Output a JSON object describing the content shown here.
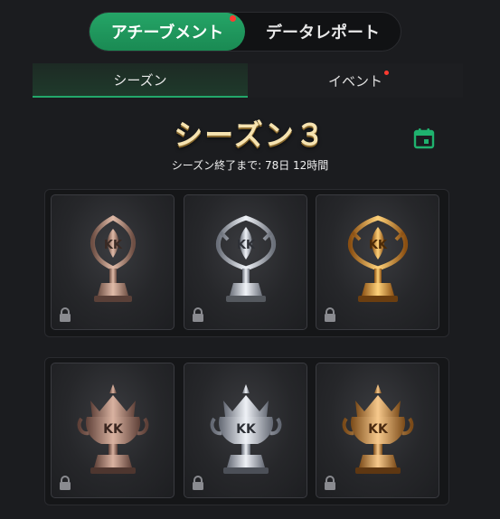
{
  "top_tabs": [
    {
      "label": "アチーブメント",
      "active": true,
      "badge": true
    },
    {
      "label": "データレポート",
      "active": false,
      "badge": false
    }
  ],
  "sub_tabs": [
    {
      "label": "シーズン",
      "active": true,
      "badge": false
    },
    {
      "label": "イベント",
      "active": false,
      "badge": true
    }
  ],
  "season": {
    "title": "シーズン３",
    "countdown": "シーズン終了まで: 78日 12時間"
  },
  "colors": {
    "accent": "#1f9a5e",
    "badge": "#ff3b30",
    "bronze": "#b48a73",
    "silver": "#c8ccd4",
    "gold": "#e6a33c"
  },
  "trophies": [
    {
      "row": "cups",
      "tier": "bronze",
      "icon": "kk-cup-bronze-icon",
      "locked": true
    },
    {
      "row": "cups",
      "tier": "silver",
      "icon": "kk-cup-silver-icon",
      "locked": true
    },
    {
      "row": "cups",
      "tier": "gold",
      "icon": "kk-cup-gold-icon",
      "locked": true
    },
    {
      "row": "crowns",
      "tier": "bronze",
      "icon": "kk-crown-bronze-icon",
      "locked": true
    },
    {
      "row": "crowns",
      "tier": "silver",
      "icon": "kk-crown-silver-icon",
      "locked": true
    },
    {
      "row": "crowns",
      "tier": "gold",
      "icon": "kk-crown-gold-icon",
      "locked": true
    }
  ]
}
